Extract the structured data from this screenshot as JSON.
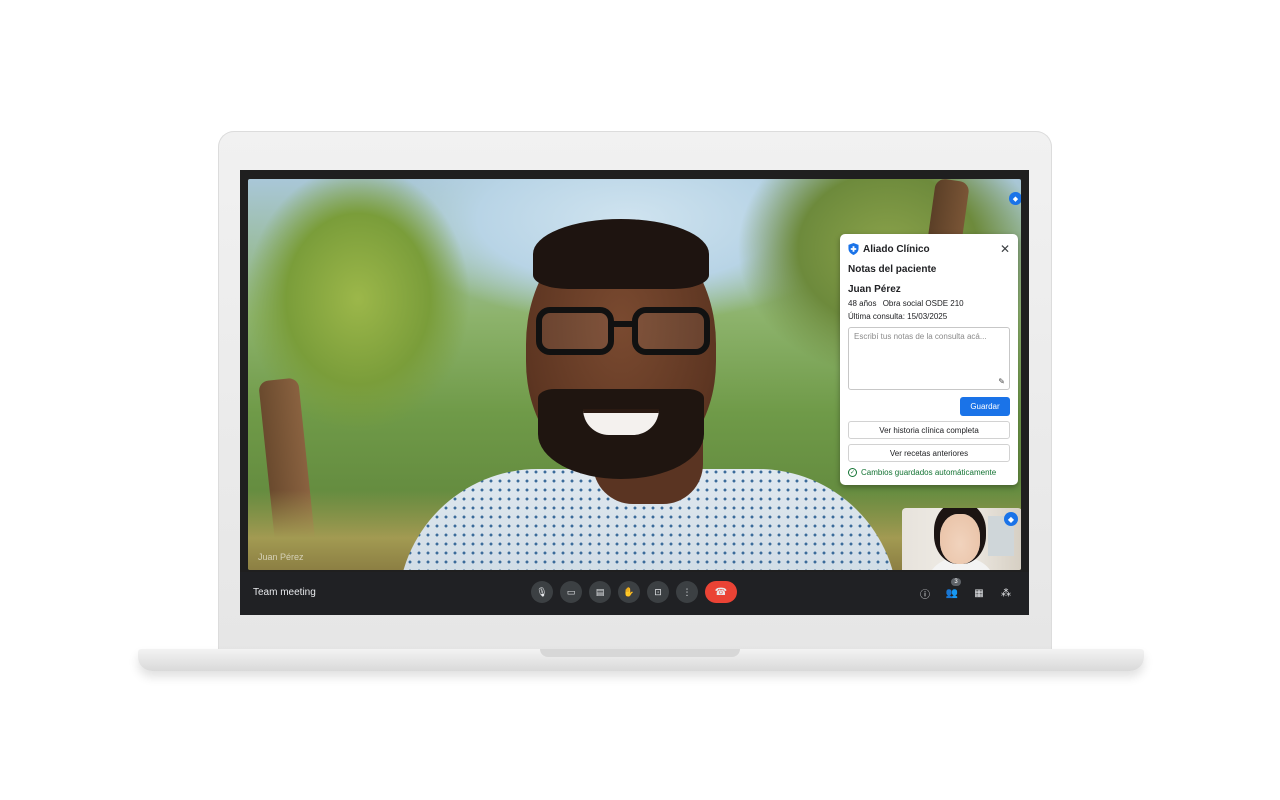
{
  "meeting": {
    "title": "Team meeting",
    "participant_name": "Juan Pérez",
    "participant_count": "3"
  },
  "panel": {
    "app_name": "Aliado Clínico",
    "close_label": "✕",
    "section_title": "Notas del paciente",
    "patient": {
      "name": "Juan Pérez",
      "age": "48 años",
      "insurance": "Obra social OSDE 210",
      "last_visit": "Última consulta: 15/03/2025"
    },
    "notes_placeholder": "Escribí tus notas de la consulta acá...",
    "save_label": "Guardar",
    "history_button": "Ver historia clínica completa",
    "prescriptions_button": "Ver recetas anteriores",
    "status": "Cambios guardados automáticamente"
  },
  "icons": {
    "mic": "🎙",
    "camera": "▭",
    "captions": "▤",
    "hand": "✋",
    "present": "⊡",
    "more": "⋮",
    "end_call": "☎",
    "info": "ⓘ",
    "people": "👥",
    "chat": "▦",
    "activities": "⁂",
    "pencil": "✎",
    "check": "✓"
  },
  "colors": {
    "accent": "#1a73e8",
    "end_call": "#ea4335",
    "success": "#137333",
    "control_bar": "#202124"
  }
}
